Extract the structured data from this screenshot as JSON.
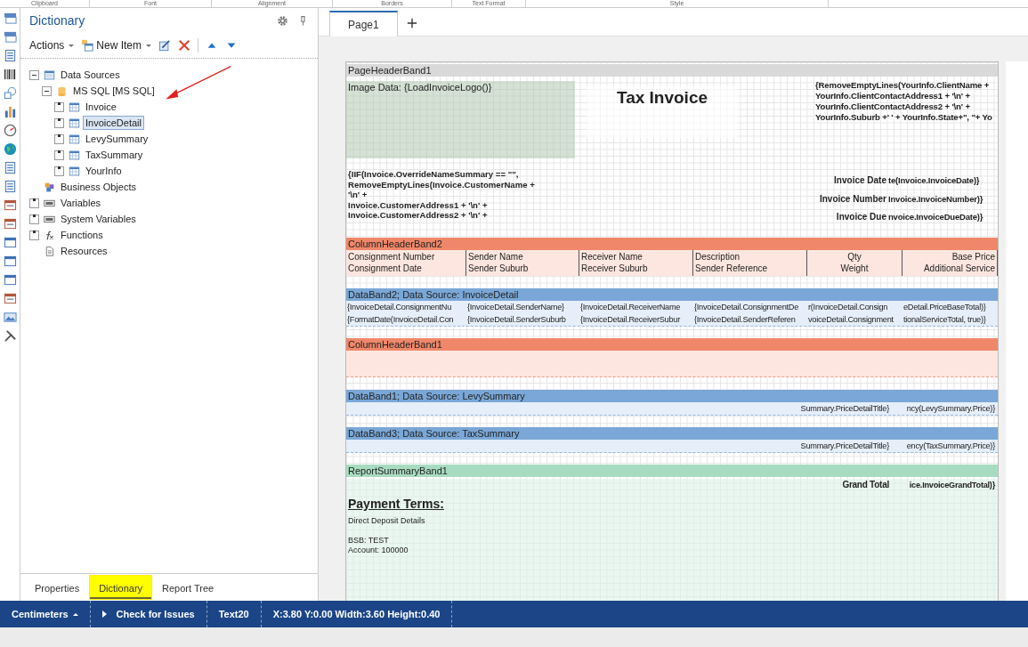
{
  "ribbon_groups": [
    "Clipboard",
    "Font",
    "Alignment",
    "Borders",
    "Text Format",
    "Style"
  ],
  "dictionary": {
    "title": "Dictionary",
    "menus": [
      "Actions",
      "New Item"
    ],
    "tree": [
      {
        "label": "Data Sources",
        "kind": "source",
        "expanded": true,
        "selected": false,
        "children": [
          {
            "label": "MS SQL [MS SQL]",
            "kind": "database",
            "expanded": true,
            "selected": false,
            "children": [
              {
                "label": "Invoice",
                "kind": "table",
                "expanded": false,
                "selected": false
              },
              {
                "label": "InvoiceDetail",
                "kind": "table",
                "expanded": false,
                "selected": true
              },
              {
                "label": "LevySummary",
                "kind": "table",
                "expanded": false,
                "selected": false
              },
              {
                "label": "TaxSummary",
                "kind": "table",
                "expanded": false,
                "selected": false
              },
              {
                "label": "YourInfo",
                "kind": "table",
                "expanded": false,
                "selected": false
              }
            ]
          }
        ]
      },
      {
        "label": "Business Objects",
        "kind": "objects",
        "selected": false
      },
      {
        "label": "Variables",
        "kind": "variables",
        "expanded": false,
        "selected": false
      },
      {
        "label": "System Variables",
        "kind": "sysvars",
        "expanded": false,
        "selected": false
      },
      {
        "label": "Functions",
        "kind": "functions",
        "expanded": false,
        "selected": false
      },
      {
        "label": "Resources",
        "kind": "resources",
        "selected": false
      }
    ]
  },
  "panel_tabs": [
    {
      "label": "Properties",
      "selected": false
    },
    {
      "label": "Dictionary",
      "selected": true
    },
    {
      "label": "Report Tree",
      "selected": false
    }
  ],
  "page_tabs": [
    {
      "label": "Page1",
      "selected": true
    }
  ],
  "bands": [
    {
      "kind": "page_header",
      "title": "PageHeaderBand1",
      "image": "Image Data: {LoadInvoiceLogo()}",
      "heading": "Tax Invoice",
      "company_lines": [
        "{RemoveEmptyLines(YourInfo.ClientName +",
        "YourInfo.ClientContactAddress1 + '\\n' +",
        "YourInfo.ClientContactAddress2 + '\\n' +",
        "YourInfo.Suburb +' ' + YourInfo.State+\", \"+ Yo"
      ],
      "customer_lines": [
        "{IIF(Invoice.OverrideNameSummary == \"\",",
        "RemoveEmptyLines(Invoice.CustomerName +",
        "'\\n' +",
        "Invoice.CustomerAddress1 + '\\n' +",
        "Invoice.CustomerAddress2 + '\\n' +"
      ],
      "info_rows": [
        {
          "label": "Invoice Date",
          "value": "te(Invoice.InvoiceDate)}"
        },
        {
          "label": "Invoice Number",
          "value": "Invoice.InvoiceNumber)}"
        },
        {
          "label": "Invoice Due",
          "value": "nvoice.InvoiceDueDate)}"
        }
      ]
    },
    {
      "kind": "column_header",
      "title": "ColumnHeaderBand2",
      "columns": [
        {
          "top": "Consignment Number",
          "bottom": "Consignment Date"
        },
        {
          "top": "Sender Name",
          "bottom": "Sender Suburb"
        },
        {
          "top": "Receiver Name",
          "bottom": "Receiver Suburb"
        },
        {
          "top": "Description",
          "bottom": "Sender Reference"
        },
        {
          "top": "Qty",
          "bottom": "Weight"
        },
        {
          "top": "Base Price",
          "bottom": "Additional Service"
        }
      ]
    },
    {
      "kind": "data",
      "title": "DataBand2; Data Source: InvoiceDetail",
      "rows": [
        [
          "{InvoiceDetail.ConsignmentNu",
          "{InvoiceDetail.SenderName}",
          "{InvoiceDetail.ReceiverName",
          "{InvoiceDetail.ConsignmentDe",
          "r(InvoiceDetail.Consign",
          "eDetail.PriceBaseTotal)}"
        ],
        [
          "{FormatDate(InvoiceDetail.Con",
          "{InvoiceDetail.SenderSuburb",
          "{InvoiceDetail.ReceiverSubur",
          "{InvoiceDetail.SenderReferen",
          "voiceDetail.Consignment",
          "tionalServiceTotal, true)}"
        ]
      ]
    },
    {
      "kind": "column_header",
      "title": "ColumnHeaderBand1"
    },
    {
      "kind": "data",
      "title": "DataBand1; Data Source: LevySummary",
      "rows": [
        [
          "Summary.PriceDetailTitle}",
          "ncy(LevySummary.Price)}"
        ]
      ]
    },
    {
      "kind": "data",
      "title": "DataBand3; Data Source: TaxSummary",
      "rows": [
        [
          "Summary.PriceDetailTitle}",
          "ency(TaxSummary.Price)}"
        ]
      ]
    },
    {
      "kind": "summary",
      "title": "ReportSummaryBand1",
      "total_label": "Grand Total",
      "total_value": "ice.InvoiceGrandTotal)}",
      "payment_heading": "Payment Terms:",
      "payment_lines": [
        "Direct Deposit Details",
        "BSB: TEST",
        "Account: 100000"
      ]
    }
  ],
  "status_bar": {
    "unit": "Centimeters",
    "check": "Check for Issues",
    "component": "Text20",
    "position": "X:3.80 Y:0.00 Width:3.60 Height:0.40"
  }
}
